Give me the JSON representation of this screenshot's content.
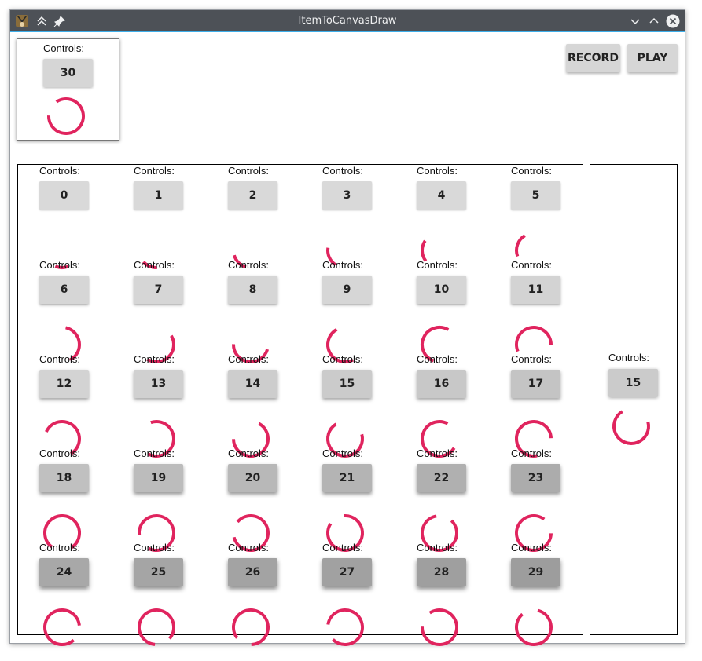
{
  "window": {
    "title": "ItemToCanvasDraw"
  },
  "toolbar": {
    "record_label": "RECORD",
    "play_label": "PLAY"
  },
  "accent": "#e0245e",
  "top_panel": {
    "label": "Controls:",
    "value": "30"
  },
  "side_panel": {
    "label": "Controls:",
    "value": "15"
  },
  "grid": {
    "label": "Controls:",
    "cells": [
      {
        "value": "0",
        "shade": "#d9d9d9"
      },
      {
        "value": "1",
        "shade": "#d9d9d9"
      },
      {
        "value": "2",
        "shade": "#d9d9d9"
      },
      {
        "value": "3",
        "shade": "#d9d9d9"
      },
      {
        "value": "4",
        "shade": "#d9d9d9"
      },
      {
        "value": "5",
        "shade": "#d9d9d9"
      },
      {
        "value": "6",
        "shade": "#d6d6d6"
      },
      {
        "value": "7",
        "shade": "#d6d6d6"
      },
      {
        "value": "8",
        "shade": "#d6d6d6"
      },
      {
        "value": "9",
        "shade": "#d6d6d6"
      },
      {
        "value": "10",
        "shade": "#d6d6d6"
      },
      {
        "value": "11",
        "shade": "#d3d3d3"
      },
      {
        "value": "12",
        "shade": "#d3d3d3"
      },
      {
        "value": "13",
        "shade": "#d0d0d0"
      },
      {
        "value": "14",
        "shade": "#cdcdcd"
      },
      {
        "value": "15",
        "shade": "#cbcbcb"
      },
      {
        "value": "16",
        "shade": "#c8c8c8"
      },
      {
        "value": "17",
        "shade": "#c4c4c4"
      },
      {
        "value": "18",
        "shade": "#c0c0c0"
      },
      {
        "value": "19",
        "shade": "#bcbcbc"
      },
      {
        "value": "20",
        "shade": "#b8b8b8"
      },
      {
        "value": "21",
        "shade": "#b4b4b4"
      },
      {
        "value": "22",
        "shade": "#b0b0b0"
      },
      {
        "value": "23",
        "shade": "#acacac"
      },
      {
        "value": "24",
        "shade": "#a8a8a8"
      },
      {
        "value": "25",
        "shade": "#a5a5a5"
      },
      {
        "value": "26",
        "shade": "#a3a3a3"
      },
      {
        "value": "27",
        "shade": "#a1a1a1"
      },
      {
        "value": "28",
        "shade": "#9f9f9f"
      },
      {
        "value": "29",
        "shade": "#9d9d9d"
      }
    ]
  }
}
